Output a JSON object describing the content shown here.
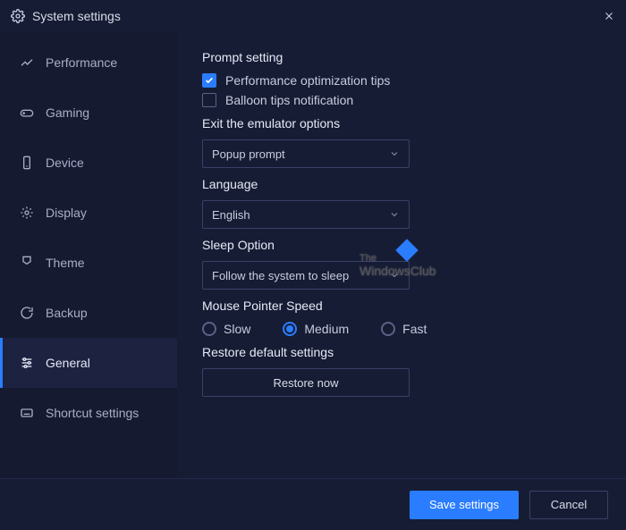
{
  "window": {
    "title": "System settings"
  },
  "sidebar": {
    "items": [
      {
        "label": "Performance"
      },
      {
        "label": "Gaming"
      },
      {
        "label": "Device"
      },
      {
        "label": "Display"
      },
      {
        "label": "Theme"
      },
      {
        "label": "Backup"
      },
      {
        "label": "General"
      },
      {
        "label": "Shortcut settings"
      }
    ]
  },
  "content": {
    "prompt_heading": "Prompt setting",
    "perf_tips_label": "Performance optimization tips",
    "balloon_label": "Balloon tips notification",
    "exit_heading": "Exit the emulator options",
    "exit_value": "Popup prompt",
    "language_heading": "Language",
    "language_value": "English",
    "sleep_heading": "Sleep Option",
    "sleep_value": "Follow the system to sleep",
    "mouse_heading": "Mouse Pointer Speed",
    "mouse_slow": "Slow",
    "mouse_medium": "Medium",
    "mouse_fast": "Fast",
    "restore_heading": "Restore default settings",
    "restore_button": "Restore now"
  },
  "footer": {
    "save": "Save settings",
    "cancel": "Cancel"
  },
  "watermark": {
    "text": "WindowsClub",
    "prefix": "The"
  }
}
